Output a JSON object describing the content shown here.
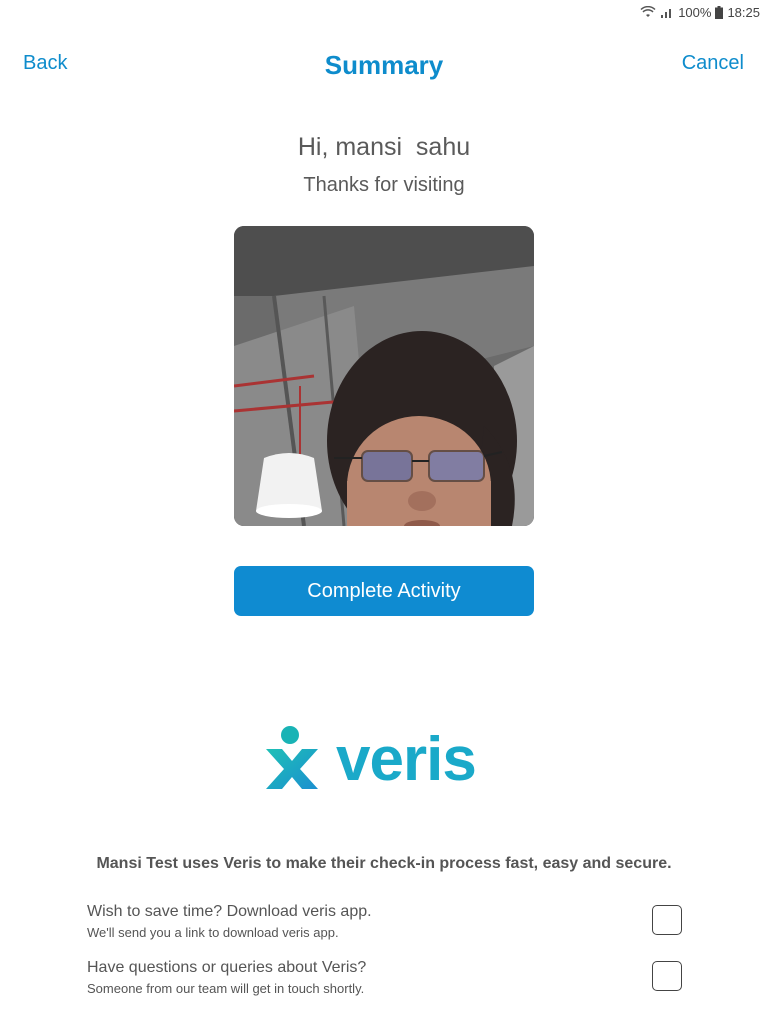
{
  "status_bar": {
    "battery": "100%",
    "time": "18:25"
  },
  "header": {
    "back_label": "Back",
    "title": "Summary",
    "cancel_label": "Cancel"
  },
  "visitor": {
    "greeting": "Hi, mansi  sahu",
    "thanks": "Thanks for visiting"
  },
  "actions": {
    "complete_label": "Complete Activity"
  },
  "brand": {
    "name": "veris",
    "accent_color": "#0f8bd1",
    "logo_color": "#1aa9c9",
    "tagline": "Mansi Test uses Veris to make their check-in process fast, easy and secure."
  },
  "options": [
    {
      "title": "Wish to save time? Download veris app.",
      "subtitle": "We'll send you a link to download veris app.",
      "checked": false
    },
    {
      "title": "Have questions or queries about Veris?",
      "subtitle": "Someone from our team will get in touch shortly.",
      "checked": false
    }
  ]
}
